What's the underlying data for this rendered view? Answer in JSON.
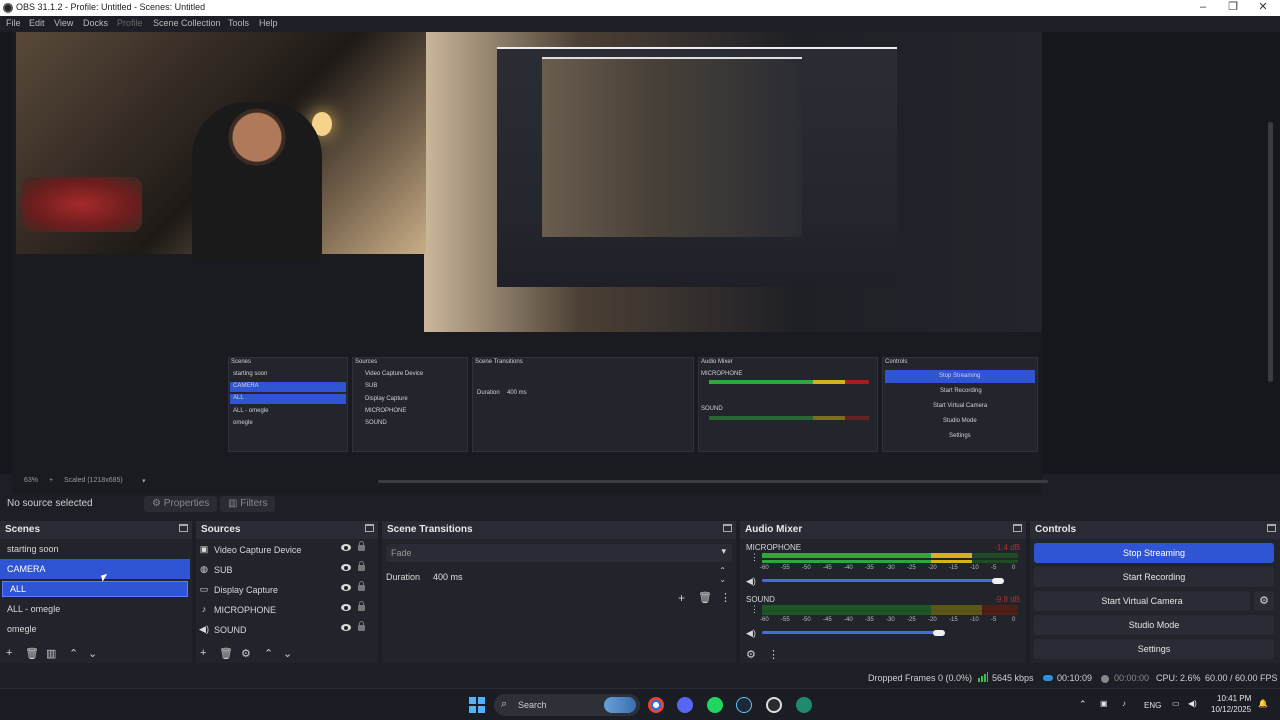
{
  "window": {
    "title": "OBS 31.1.2 - Profile: Untitled - Scenes: Untitled",
    "minimize_glyph": "–",
    "maximize_glyph": "❐",
    "close_glyph": "✕"
  },
  "menu": [
    "File",
    "Edit",
    "View",
    "Docks",
    "Profile",
    "Scene Collection",
    "Tools",
    "Help"
  ],
  "preview": {
    "zoom": "63%",
    "zoom_plus": "+",
    "scaled": "Scaled (1218x685)"
  },
  "source_bar": {
    "no_source": "No source selected",
    "properties": "Properties",
    "filters": "Filters"
  },
  "scenes": {
    "title": "Scenes",
    "items": [
      "starting soon",
      "CAMERA",
      "ALL",
      "ALL - omegle",
      "omegle"
    ],
    "selected_index": 1
  },
  "sources": {
    "title": "Sources",
    "items": [
      {
        "label": "Video Capture Device",
        "icon": "camera-icon"
      },
      {
        "label": "SUB",
        "icon": "globe-icon"
      },
      {
        "label": "Display Capture",
        "icon": "monitor-icon"
      },
      {
        "label": "MICROPHONE",
        "icon": "microphone-icon"
      },
      {
        "label": "SOUND",
        "icon": "speaker-icon"
      }
    ]
  },
  "transitions": {
    "title": "Scene Transitions",
    "selected": "Fade",
    "duration_label": "Duration",
    "duration_value": "400 ms"
  },
  "mixer": {
    "title": "Audio Mixer",
    "scale": [
      "-60",
      "-55",
      "-50",
      "-45",
      "-40",
      "-35",
      "-30",
      "-25",
      "-20",
      "-15",
      "-10",
      "-5",
      "0"
    ],
    "channels": [
      {
        "name": "MICROPHONE",
        "db": "-1.4 dB",
        "fader": 0.92,
        "level": 0.82
      },
      {
        "name": "SOUND",
        "db": "-9.8 dB",
        "fader": 0.69,
        "level": 0.0
      }
    ]
  },
  "controls": {
    "title": "Controls",
    "buttons": [
      "Stop Streaming",
      "Start Recording",
      "Start Virtual Camera",
      "Studio Mode",
      "Settings"
    ]
  },
  "status": {
    "dropped": "Dropped Frames 0 (0.0%)",
    "kbps": "5645 kbps",
    "stream_time": "00:10:09",
    "rec_time": "00:00:00",
    "cpu": "CPU: 2.6%",
    "fps": "60.00 / 60.00 FPS"
  },
  "taskbar": {
    "search_placeholder": "Search",
    "language": "ENG",
    "time": "10:41 PM",
    "date": "10/12/2025"
  },
  "colors": {
    "accent": "#2f55d4",
    "meter_green": "#2ea83b",
    "meter_yellow": "#d4b21f",
    "meter_red": "#a51d1d"
  }
}
